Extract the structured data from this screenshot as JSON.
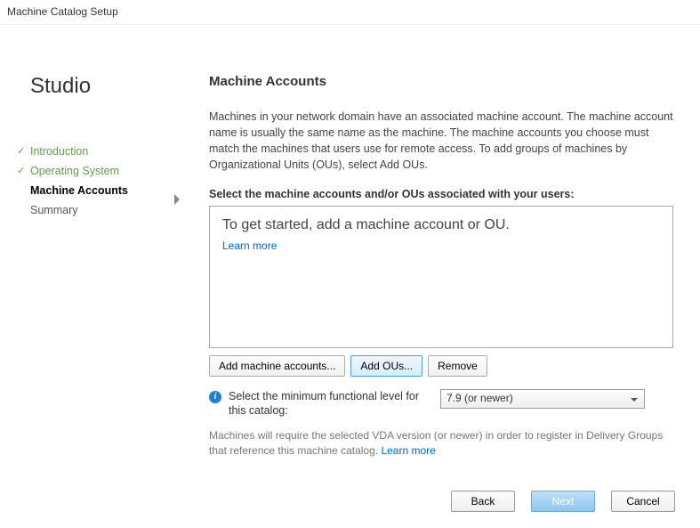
{
  "window": {
    "title": "Machine Catalog Setup"
  },
  "brand": "Studio",
  "steps": {
    "introduction": "Introduction",
    "operating_system": "Operating System",
    "machine_accounts": "Machine Accounts",
    "summary": "Summary"
  },
  "main": {
    "heading": "Machine Accounts",
    "description": "Machines in your network domain have an associated machine account. The machine account name is usually the same name as the machine. The machine accounts you choose must match the machines that users use for remote access. To add groups of machines by Organizational Units (OUs), select Add OUs.",
    "select_label": "Select the machine accounts and/or OUs associated with your users:",
    "empty_prompt": "To get started, add a machine account or OU.",
    "learn_more": "Learn more"
  },
  "buttons": {
    "add_accounts": "Add machine accounts...",
    "add_ous": "Add OUs...",
    "remove": "Remove"
  },
  "functional": {
    "label": "Select the minimum functional level for this catalog:",
    "selected": "7.9 (or newer)"
  },
  "footnote": {
    "text": "Machines will require the selected VDA version (or newer) in order to register in Delivery Groups that reference this machine catalog. ",
    "learn_more": "Learn more"
  },
  "footer": {
    "back": "Back",
    "next": "Next",
    "cancel": "Cancel"
  }
}
